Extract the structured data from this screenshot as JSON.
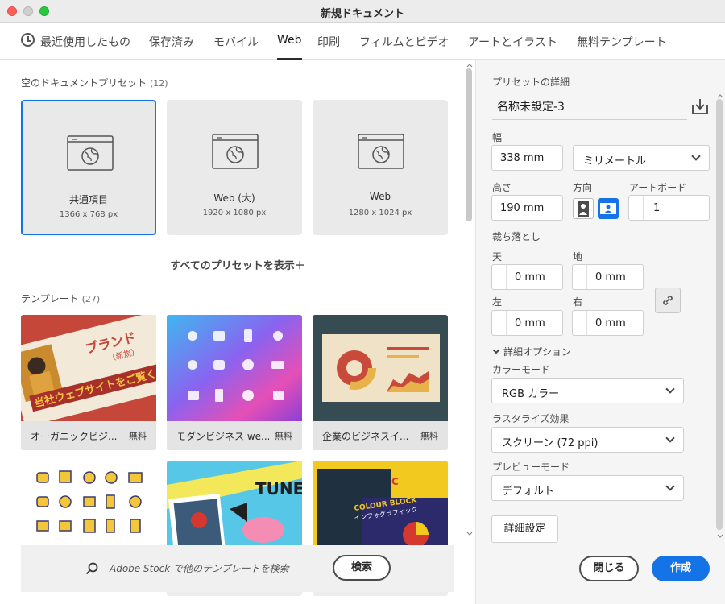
{
  "window": {
    "title": "新規ドキュメント"
  },
  "colors": {
    "accent": "#1473e6",
    "close": "#ff5f57",
    "minimize": "#febc2e",
    "zoom": "#28c840"
  },
  "tabs": [
    {
      "label": "最近使用したもの",
      "icon": "clock-icon"
    },
    {
      "label": "保存済み"
    },
    {
      "label": "モバイル"
    },
    {
      "label": "Web"
    },
    {
      "label": "印刷"
    },
    {
      "label": "フィルムとビデオ"
    },
    {
      "label": "アートとイラスト"
    },
    {
      "label": "無料テンプレート"
    }
  ],
  "presets": {
    "heading": "空のドキュメントプリセット",
    "count": "(12)",
    "show_all": "すべてのプリセットを表示＋",
    "items": [
      {
        "name": "共通項目",
        "size": "1366 x 768 px",
        "icon": "web-globe-icon"
      },
      {
        "name": "Web (大)",
        "size": "1920 x 1080 px",
        "icon": "web-globe-icon"
      },
      {
        "name": "Web",
        "size": "1280 x 1024 px",
        "icon": "web-globe-icon"
      }
    ]
  },
  "templates": {
    "heading": "テンプレート",
    "count": "(27)",
    "items": [
      {
        "name": "オーガニックビジ...",
        "badge": "無料"
      },
      {
        "name": "モダンビジネス we...",
        "badge": "無料"
      },
      {
        "name": "企業のビジネスイ...",
        "badge": "無料"
      }
    ],
    "thumb_text": {
      "brand": "ブランド",
      "brand_sub": "（新規）",
      "welcome": "当社ウェブサイトをご覧ください",
      "tune": "TUNE",
      "colour_block": "COLOUR BLOCK",
      "infographic": "インフォグラフィック"
    }
  },
  "search": {
    "text": "Adobe Stock で他のテンプレートを検索",
    "button": "検索",
    "icon": "search-icon"
  },
  "details": {
    "heading": "プリセットの詳細",
    "name": "名称未設定-3",
    "save_icon": "save-preset-icon",
    "width_label": "幅",
    "width_value": "338 mm",
    "unit": "ミリメートル",
    "height_label": "高さ",
    "height_value": "190 mm",
    "orientation_label": "方向",
    "artboard_label": "アートボード",
    "artboard_value": "1",
    "bleed_label": "裁ち落とし",
    "top_label": "天",
    "top_value": "0 mm",
    "bottom_label": "地",
    "bottom_value": "0 mm",
    "left_label": "左",
    "left_value": "0 mm",
    "right_label": "右",
    "right_value": "0 mm",
    "advanced_label": "詳細オプション",
    "color_mode_label": "カラーモード",
    "color_mode_value": "RGB カラー",
    "raster_label": "ラスタライズ効果",
    "raster_value": "スクリーン (72 ppi)",
    "preview_label": "プレビューモード",
    "preview_value": "デフォルト",
    "more_settings": "詳細設定"
  },
  "footer": {
    "close": "閉じる",
    "create": "作成"
  }
}
